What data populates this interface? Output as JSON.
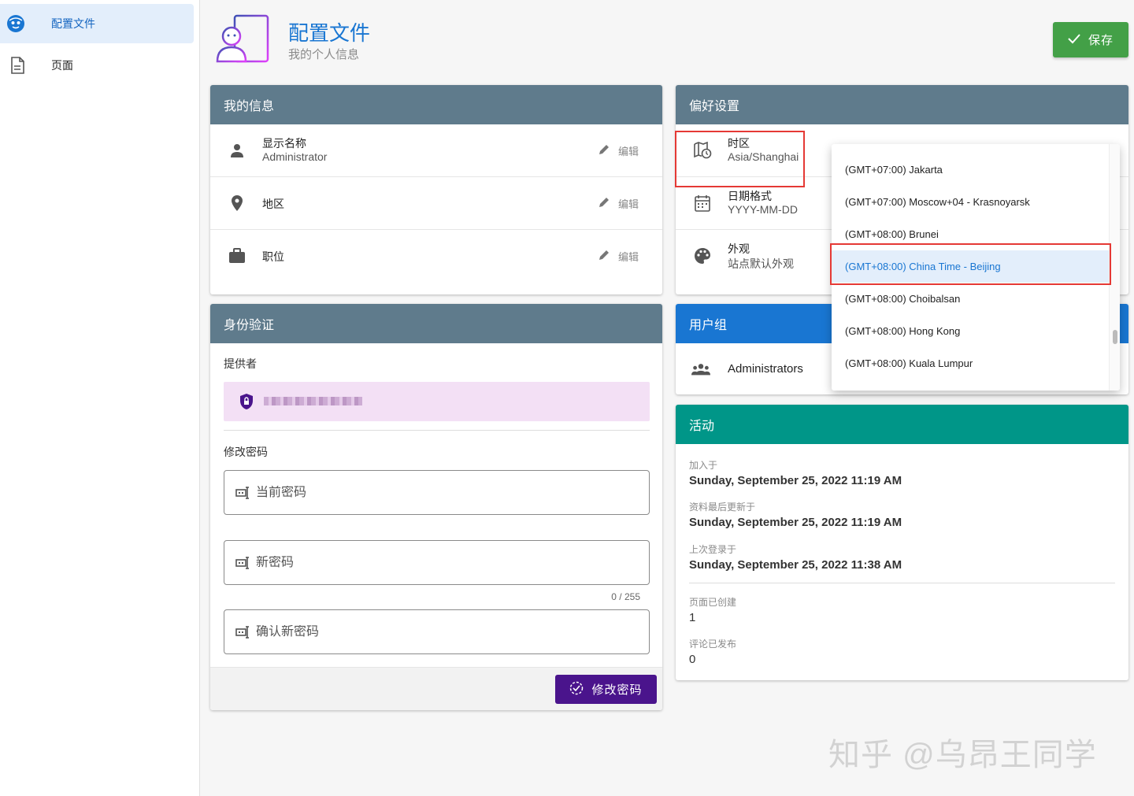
{
  "sidebar": {
    "items": [
      {
        "label": "配置文件",
        "icon": "profile-face-icon"
      },
      {
        "label": "页面",
        "icon": "document-icon"
      }
    ]
  },
  "header": {
    "title": "配置文件",
    "subtitle": "我的个人信息",
    "save_label": "保存",
    "icon": "profile-badge-icon"
  },
  "my_info": {
    "title": "我的信息",
    "rows": [
      {
        "label": "显示名称",
        "value": "Administrator",
        "edit": "编辑",
        "icon": "person-icon"
      },
      {
        "label": "地区",
        "value": "",
        "edit": "编辑",
        "icon": "location-pin-icon"
      },
      {
        "label": "职位",
        "value": "",
        "edit": "编辑",
        "icon": "briefcase-icon"
      }
    ]
  },
  "auth": {
    "title": "身份验证",
    "provider_label": "提供者",
    "change_password_label": "修改密码",
    "current_password_placeholder": "当前密码",
    "new_password_placeholder": "新密码",
    "confirm_password_placeholder": "确认新密码",
    "counter": "0 / 255",
    "change_password_button": "修改密码"
  },
  "preferences": {
    "title": "偏好设置",
    "rows": [
      {
        "label": "时区",
        "value": "Asia/Shanghai",
        "icon": "map-clock-icon"
      },
      {
        "label": "日期格式",
        "value": "YYYY-MM-DD",
        "icon": "calendar-icon"
      },
      {
        "label": "外观",
        "value": "站点默认外观",
        "icon": "palette-icon"
      }
    ]
  },
  "groups": {
    "title": "用户组",
    "items": [
      {
        "label": "Administrators",
        "icon": "group-icon"
      }
    ]
  },
  "activity": {
    "title": "活动",
    "joined_label": "加入于",
    "joined_value": "Sunday, September 25, 2022 11:19 AM",
    "updated_label": "资料最后更新于",
    "updated_value": "Sunday, September 25, 2022 11:19 AM",
    "last_login_label": "上次登录于",
    "last_login_value": "Sunday, September 25, 2022 11:38 AM",
    "pages_label": "页面已创建",
    "pages_value": "1",
    "comments_label": "评论已发布",
    "comments_value": "0"
  },
  "timezone_dropdown": {
    "options": [
      "(GMT+07:00) Jakarta",
      "(GMT+07:00) Moscow+04 - Krasnoyarsk",
      "(GMT+08:00) Brunei",
      "(GMT+08:00) China Time - Beijing",
      "(GMT+08:00) Choibalsan",
      "(GMT+08:00) Hong Kong",
      "(GMT+08:00) Kuala Lumpur"
    ],
    "selected": "(GMT+08:00) China Time - Beijing"
  },
  "watermark": "知乎 @乌昂王同学",
  "colors": {
    "accent": "#1976d2",
    "card_header": "#5f7b8c",
    "save": "#43a047",
    "activity": "#009688",
    "change_password": "#4a148c",
    "highlight": "#e53935"
  }
}
